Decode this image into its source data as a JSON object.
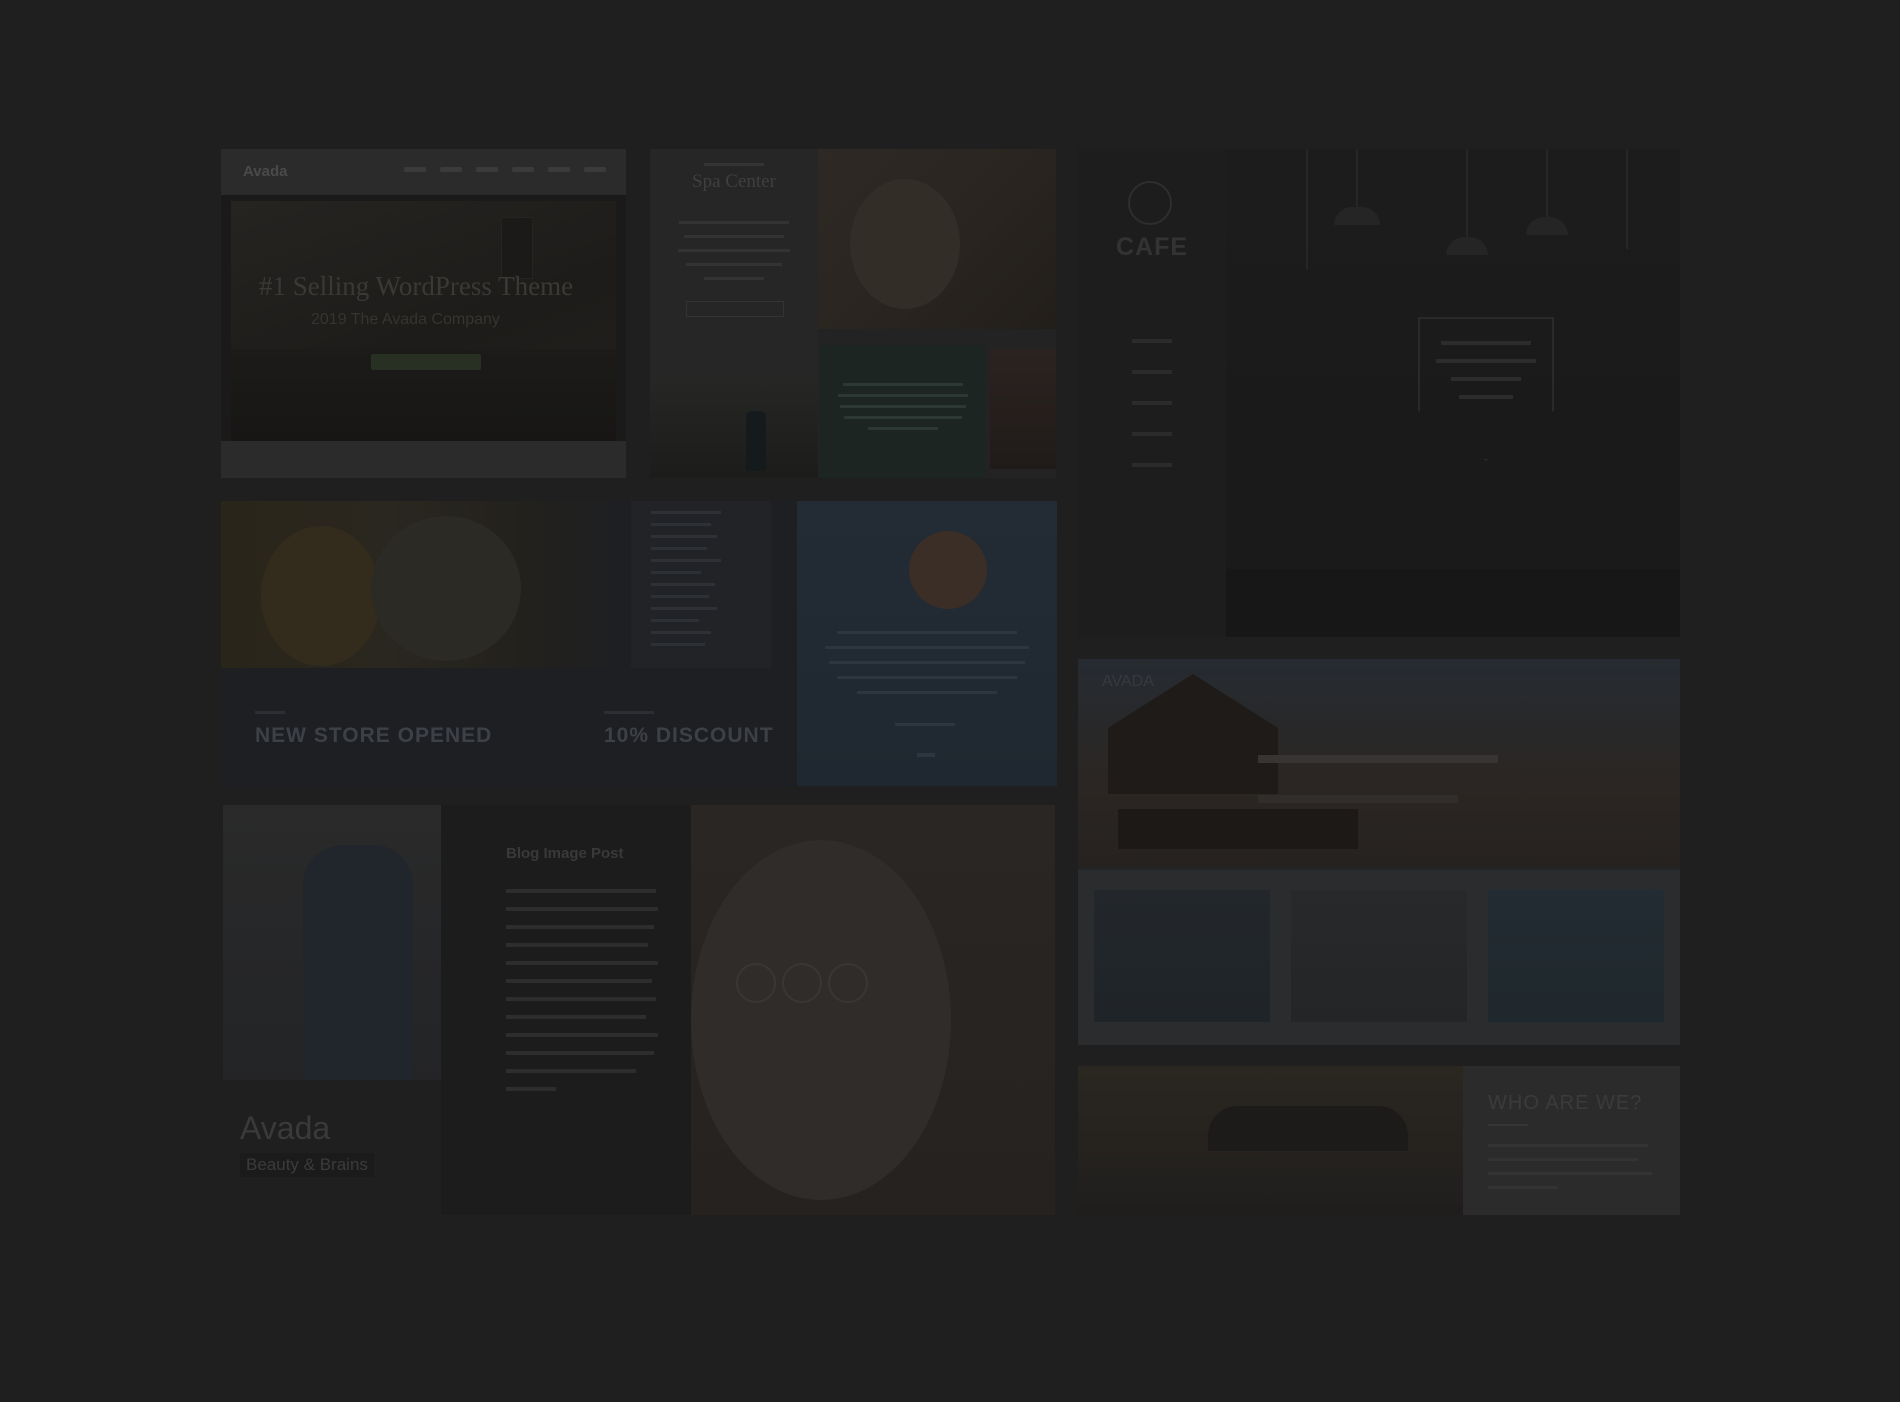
{
  "tiles": {
    "business": {
      "logo": "Avada",
      "headline": "#1 Selling WordPress Theme",
      "subheadline": "2019 The Avada Company"
    },
    "spa": {
      "title": "Spa Center"
    },
    "cafe": {
      "logo": "CAFE"
    },
    "store": {
      "card1_title": "NEW STORE OPENED",
      "card2_title": "10% DISCOUNT"
    },
    "blog": {
      "brand": "Avada",
      "tagline": "Beauty & Brains",
      "post_title": "Blog Image Post"
    },
    "resort": {
      "logo": "AVADA"
    },
    "about": {
      "heading": "WHO ARE WE?"
    }
  },
  "colors": {
    "overlay_background": "#1f1f1f"
  }
}
